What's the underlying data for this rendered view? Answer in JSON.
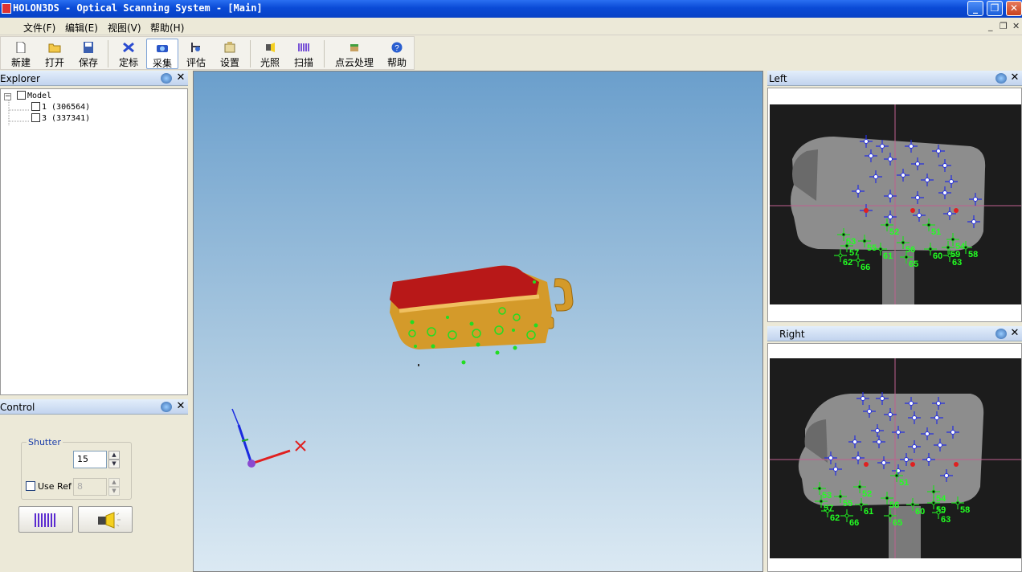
{
  "window": {
    "title": "HOLON3DS - Optical Scanning System - [Main]",
    "minimize": "_",
    "maximize": "❐",
    "close": "✕"
  },
  "menu": {
    "items": [
      "文件(F)",
      "编辑(E)",
      "视图(V)",
      "帮助(H)"
    ],
    "mdi_controls": [
      "_",
      "❐",
      "✕"
    ]
  },
  "toolbar": {
    "items": [
      {
        "label": "新建",
        "icon": "new-file-icon"
      },
      {
        "label": "打开",
        "icon": "open-folder-icon"
      },
      {
        "label": "保存",
        "icon": "save-disk-icon"
      },
      {
        "label": "定标",
        "icon": "calibrate-icon"
      },
      {
        "label": "采集",
        "icon": "capture-camera-icon",
        "active": true
      },
      {
        "label": "评估",
        "icon": "evaluate-icon"
      },
      {
        "label": "设置",
        "icon": "settings-icon"
      },
      {
        "label": "光照",
        "icon": "light-icon"
      },
      {
        "label": "扫描",
        "icon": "scan-icon"
      },
      {
        "label": "点云处理",
        "icon": "point-cloud-icon"
      },
      {
        "label": "帮助",
        "icon": "help-icon"
      }
    ]
  },
  "explorer": {
    "title": "Explorer",
    "root": "Model",
    "expander": "−",
    "children": [
      "1 (306564)",
      "3 (337341)"
    ]
  },
  "control": {
    "title": "Control",
    "shutter_label": "Shutter",
    "shutter_value": "15",
    "use_ref_label": "Use Ref",
    "use_ref_value": "8",
    "use_ref_checked": false
  },
  "cameras": {
    "left": {
      "title": "Left",
      "green_labels": [
        "51",
        "52",
        "53",
        "54",
        "55",
        "56",
        "57",
        "58",
        "59",
        "60",
        "61",
        "62",
        "63",
        "65",
        "66"
      ]
    },
    "right": {
      "title": "Right",
      "green_labels": [
        "51",
        "52",
        "53",
        "54",
        "55",
        "56",
        "57",
        "58",
        "59",
        "60",
        "61",
        "62",
        "63",
        "65",
        "66"
      ]
    }
  },
  "colors": {
    "titlebar": "#0a4ad6",
    "viewport_top": "#6b9fcc",
    "viewport_bottom": "#dbe9f3",
    "model_body": "#d49a2a",
    "model_top": "#c01818",
    "marker_green": "#22dd22",
    "marker_blue": "#1a22cc",
    "axis_x": "#e02020",
    "axis_y": "#22aa22",
    "axis_z": "#1a2ae0"
  }
}
